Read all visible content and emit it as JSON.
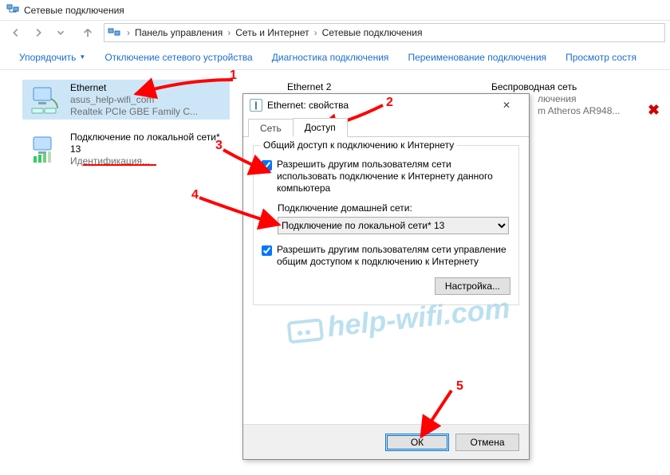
{
  "window": {
    "title": "Сетевые подключения"
  },
  "breadcrumb": {
    "items": [
      "Панель управления",
      "Сеть и Интернет",
      "Сетевые подключения"
    ]
  },
  "toolbar": {
    "organize": "Упорядочить",
    "disable": "Отключение сетевого устройства",
    "diagnose": "Диагностика подключения",
    "rename": "Переименование подключения",
    "view": "Просмотр состя"
  },
  "connections": {
    "ethernet": {
      "name": "Ethernet",
      "line2": "asus_help-wifi_com",
      "line3": "Realtek PCIe GBE Family C..."
    },
    "lan13": {
      "name": "Подключение по локальной сети* 13",
      "line3": "Идентификация..."
    },
    "ethernet2": {
      "name": "Ethernet 2"
    },
    "wifi": {
      "name": "Беспроводная сеть",
      "line2": "лючения",
      "line3": "m Atheros AR948..."
    }
  },
  "dialog": {
    "title": "Ethernet: свойства",
    "tabs": {
      "net": "Сеть",
      "sharing": "Доступ"
    },
    "group_legend": "Общий доступ к подключению к Интернету",
    "cb1": "Разрешить другим пользователям сети использовать подключение к Интернету данного компьютера",
    "home_label": "Подключение домашней сети:",
    "home_value": "Подключение по локальной сети* 13",
    "cb2": "Разрешить другим пользователям сети управление общим доступом к подключению к Интернету",
    "settings_btn": "Настройка...",
    "ok": "ОК",
    "cancel": "Отмена"
  },
  "annotations": {
    "n1": "1",
    "n2": "2",
    "n3": "3",
    "n4": "4",
    "n5": "5"
  },
  "watermark": "help-wifi.com"
}
